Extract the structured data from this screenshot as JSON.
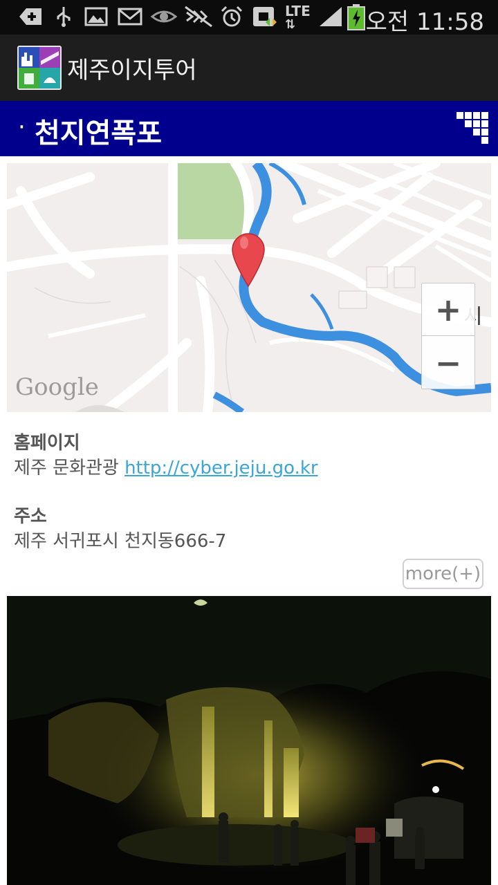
{
  "status_bar": {
    "icons": [
      "add-icon",
      "usb-icon",
      "image-icon",
      "mail-icon",
      "eye-icon",
      "mute-icon",
      "alarm-icon",
      "sync-icon",
      "lte-icon",
      "signal-icon",
      "battery-icon"
    ],
    "lte_label": "LTE",
    "time": "오전 11:58"
  },
  "app_bar": {
    "title": "제주이지투어"
  },
  "page": {
    "bullet": "·",
    "title": "천지연폭포"
  },
  "map": {
    "label_partial": "시",
    "zoom_in": "+",
    "zoom_out": "−",
    "attribution": "Google"
  },
  "info": {
    "homepage_label": "홈페이지",
    "homepage_prefix": "제주 문화관광 ",
    "homepage_link": "http://cyber.jeju.go.kr",
    "address_label": "주소",
    "address_value": "제주 서귀포시 천지동666-7",
    "more_button": "more(+)"
  },
  "colors": {
    "title_band": "#00008c",
    "link": "#3aa6d8",
    "river": "#3d8fe0",
    "park": "#b9d7a3"
  }
}
